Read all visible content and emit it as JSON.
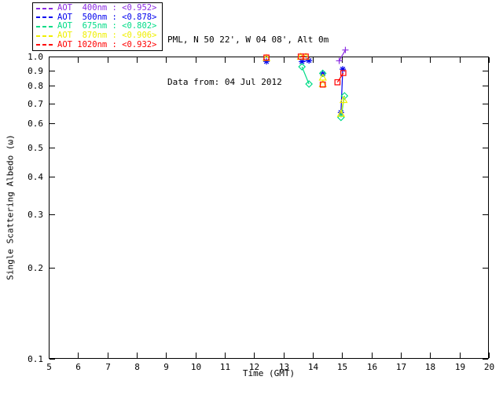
{
  "header": {
    "line1": "PML, N 50 22', W 04 08', Alt 0m",
    "line2": "Data from: 04 Jul 2012"
  },
  "legend": {
    "items": [
      {
        "label": "AOT  400nm : <0.952>",
        "color": "#8A2BE2"
      },
      {
        "label": "AOT  500nm : <0.878>",
        "color": "#0000EE"
      },
      {
        "label": "AOT  675nm : <0.802>",
        "color": "#00DC87"
      },
      {
        "label": "AOT  870nm : <0.906>",
        "color": "#EFEF00"
      },
      {
        "label": "AOT 1020nm : <0.932>",
        "color": "#FF0000"
      }
    ]
  },
  "chart_data": {
    "type": "scatter",
    "title": "",
    "xlabel": "Time (GMT)",
    "ylabel": "Single Scattering Albedo (ω)",
    "xlim": [
      5,
      20
    ],
    "ylim": [
      0.1,
      1.0
    ],
    "y_log": true,
    "grid": false,
    "axis_color": "#000000",
    "x_ticks": [
      5,
      6,
      7,
      8,
      9,
      10,
      11,
      12,
      13,
      14,
      15,
      16,
      17,
      18,
      19,
      20
    ],
    "y_ticks": [
      1.0,
      0.9,
      0.8,
      0.7,
      0.6,
      0.5,
      0.4,
      0.3,
      0.2,
      0.1
    ],
    "y_tick_labels": [
      "1.0",
      "0.9",
      "0.8",
      "0.7",
      "0.6",
      "0.5",
      "0.4",
      "0.3",
      "0.2",
      "0.1"
    ],
    "series": [
      {
        "name": "AOT 400nm",
        "wavelength_nm": 400,
        "legend_mean": 0.952,
        "color": "#8A2BE2",
        "marker": "plus",
        "points": [
          [
            14.9,
            0.968
          ],
          [
            15.11,
            1.051
          ]
        ],
        "segments": [
          [
            [
              14.9,
              0.968
            ],
            [
              15.11,
              1.051
            ]
          ]
        ]
      },
      {
        "name": "AOT 500nm",
        "wavelength_nm": 500,
        "legend_mean": 0.878,
        "color": "#0000EE",
        "marker": "asterisk",
        "points": [
          [
            12.42,
            0.963
          ],
          [
            13.63,
            0.962
          ],
          [
            13.87,
            0.97
          ],
          [
            14.34,
            0.877
          ],
          [
            15.02,
            0.908
          ],
          [
            14.96,
            0.653
          ]
        ],
        "segments": [
          [
            [
              13.63,
              0.962
            ],
            [
              13.87,
              0.97
            ]
          ],
          [
            [
              15.02,
              0.908
            ],
            [
              14.96,
              0.653
            ]
          ]
        ]
      },
      {
        "name": "AOT 675nm",
        "wavelength_nm": 675,
        "legend_mean": 0.802,
        "color": "#00DC87",
        "marker": "diamond",
        "points": [
          [
            13.63,
            0.925
          ],
          [
            13.87,
            0.811
          ],
          [
            14.34,
            0.88
          ],
          [
            15.08,
            0.741
          ],
          [
            14.96,
            0.629
          ]
        ],
        "segments": [
          [
            [
              13.63,
              0.925
            ],
            [
              13.87,
              0.811
            ]
          ],
          [
            [
              15.08,
              0.741
            ],
            [
              14.96,
              0.629
            ]
          ]
        ]
      },
      {
        "name": "AOT 870nm",
        "wavelength_nm": 870,
        "legend_mean": 0.906,
        "color": "#EFEF00",
        "marker": "triangle",
        "points": [
          [
            12.42,
            0.99
          ],
          [
            13.59,
            0.999
          ],
          [
            13.76,
            0.999
          ],
          [
            14.34,
            0.853
          ],
          [
            14.34,
            0.812
          ],
          [
            15.05,
            0.719
          ],
          [
            14.96,
            0.647
          ]
        ],
        "segments": [
          [
            [
              15.05,
              0.719
            ],
            [
              14.96,
              0.647
            ]
          ]
        ]
      },
      {
        "name": "AOT 1020nm",
        "wavelength_nm": 1020,
        "legend_mean": 0.932,
        "color": "#FF0000",
        "marker": "square",
        "points": [
          [
            12.42,
            0.992
          ],
          [
            13.59,
            1.0
          ],
          [
            13.76,
            1.0
          ],
          [
            14.34,
            0.808
          ],
          [
            14.84,
            0.822
          ],
          [
            15.04,
            0.882
          ]
        ],
        "segments": [
          [
            [
              13.59,
              1.0
            ],
            [
              13.76,
              1.0
            ]
          ],
          [
            [
              14.84,
              0.822
            ],
            [
              15.04,
              0.882
            ]
          ]
        ]
      }
    ]
  }
}
